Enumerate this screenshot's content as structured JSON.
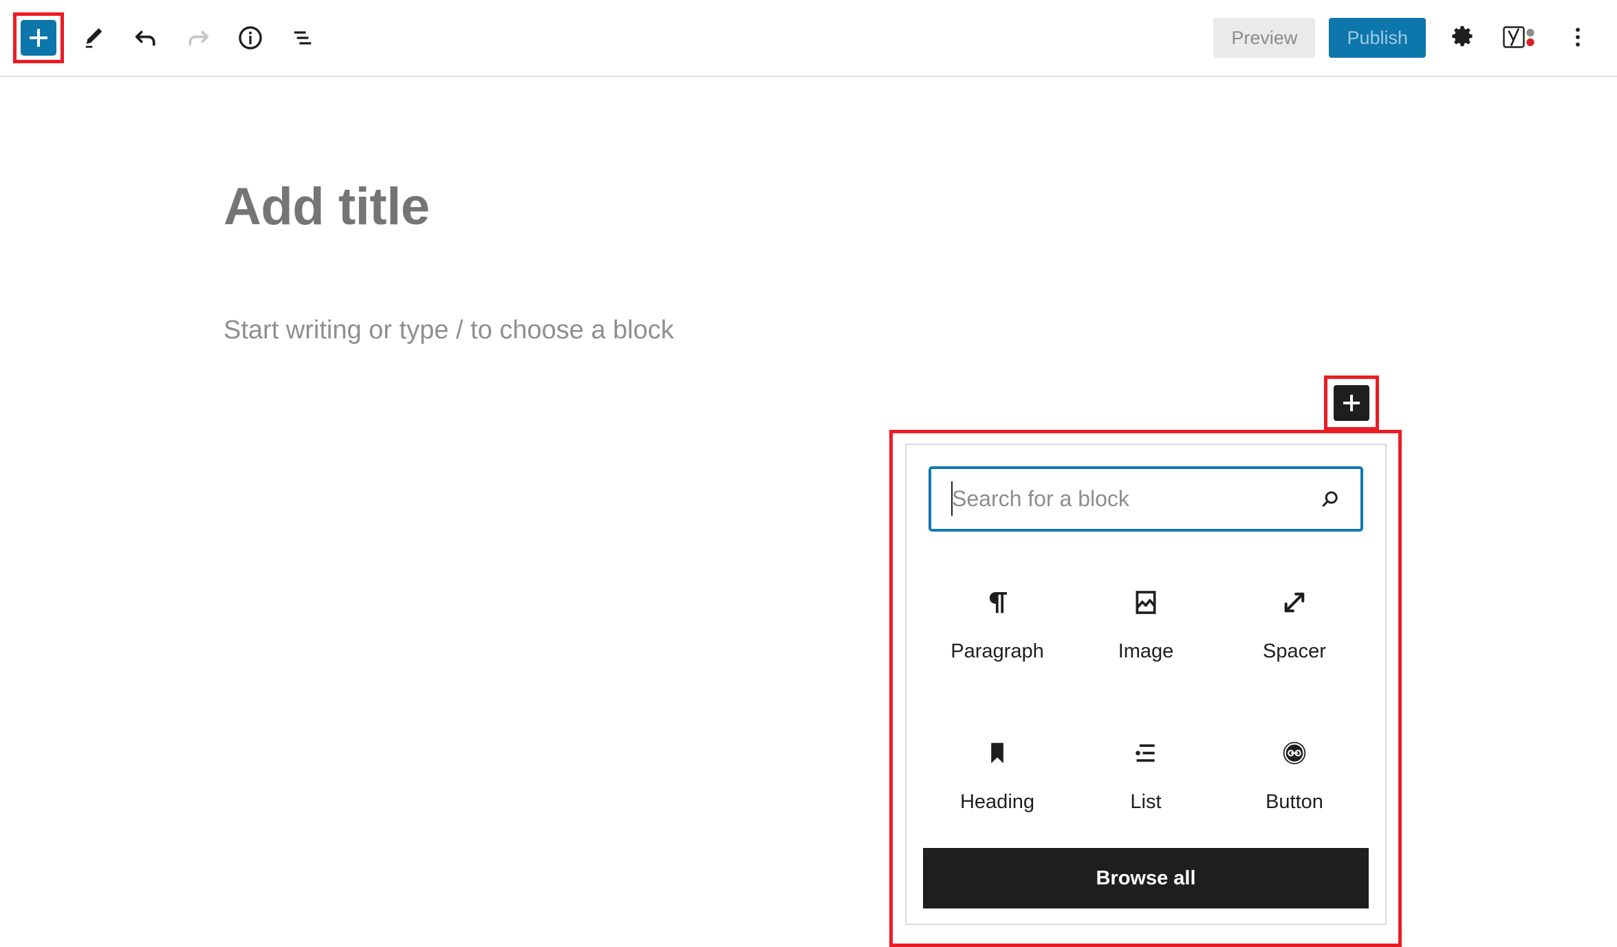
{
  "colors": {
    "accent_blue": "#0d76ab",
    "highlight_red": "#ed1c24",
    "dark": "#1e1e1e",
    "focus_blue": "#1178b4",
    "yoast_grey_dot": "#8c8c8c",
    "yoast_red_dot": "#d8232a"
  },
  "header": {
    "left_tools": [
      {
        "name": "block-inserter-toggle",
        "icon": "plus-icon",
        "label": "Toggle block inserter",
        "highlighted": true
      },
      {
        "name": "edit-mode",
        "icon": "pencil-icon",
        "label": "Edit"
      },
      {
        "name": "undo",
        "icon": "undo-arrow-icon",
        "label": "Undo"
      },
      {
        "name": "redo",
        "icon": "redo-arrow-icon",
        "label": "Redo",
        "disabled": true
      },
      {
        "name": "details",
        "icon": "info-circle-icon",
        "label": "Details"
      },
      {
        "name": "list-view",
        "icon": "list-view-icon",
        "label": "List view"
      }
    ],
    "preview_label": "Preview",
    "publish_label": "Publish",
    "right_tools": [
      {
        "name": "settings",
        "icon": "gear-icon",
        "label": "Settings"
      },
      {
        "name": "yoast-seo",
        "icon": "yoast-logo-icon",
        "label": "Yoast SEO"
      },
      {
        "name": "more-options",
        "icon": "vertical-ellipsis-icon",
        "label": "Options"
      }
    ]
  },
  "editor": {
    "title_placeholder": "Add title",
    "body_placeholder": "Start writing or type / to choose a block",
    "appender_icon": "plus-icon"
  },
  "inserter": {
    "search_placeholder": "Search for a block",
    "search_value": "",
    "search_icon": "magnifier-icon",
    "blocks": [
      {
        "label": "Paragraph",
        "icon": "pilcrow-icon"
      },
      {
        "label": "Image",
        "icon": "image-icon"
      },
      {
        "label": "Spacer",
        "icon": "diagonal-arrows-icon"
      },
      {
        "label": "Heading",
        "icon": "bookmark-icon"
      },
      {
        "label": "List",
        "icon": "bullet-list-icon"
      },
      {
        "label": "Button",
        "icon": "button-circle-icon"
      }
    ],
    "browse_all_label": "Browse all"
  }
}
